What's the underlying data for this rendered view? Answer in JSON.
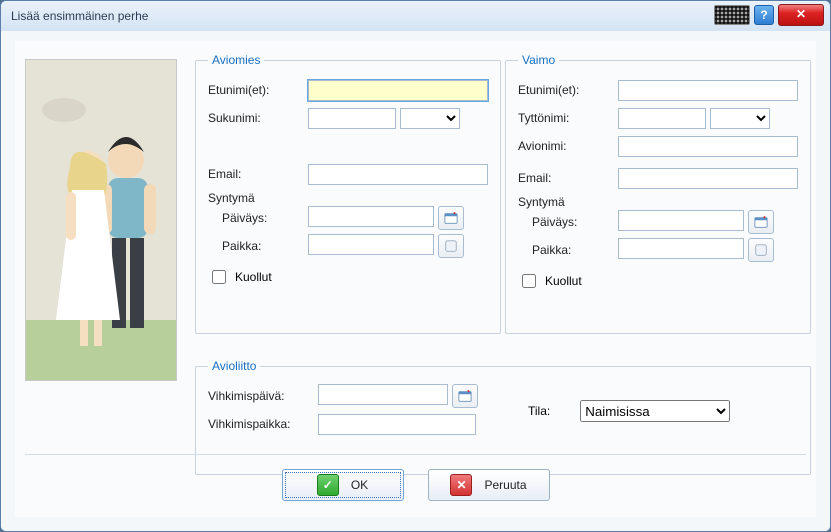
{
  "window": {
    "title": "Lisää ensimmäinen perhe"
  },
  "husband": {
    "legend": "Aviomies",
    "firstname_label": "Etunimi(et):",
    "surname_label": "Sukunimi:",
    "email_label": "Email:",
    "birth_label": "Syntymä",
    "date_label": "Päiväys:",
    "place_label": "Paikka:",
    "dead_label": "Kuollut",
    "firstname": "",
    "surname": "",
    "surname_suffix": "",
    "email": "",
    "birth_date": "",
    "birth_place": "",
    "dead": false
  },
  "wife": {
    "legend": "Vaimo",
    "firstname_label": "Etunimi(et):",
    "maiden_label": "Tyttönimi:",
    "married_name_label": "Avionimi:",
    "email_label": "Email:",
    "birth_label": "Syntymä",
    "date_label": "Päiväys:",
    "place_label": "Paikka:",
    "dead_label": "Kuollut",
    "firstname": "",
    "maiden": "",
    "maiden_suffix": "",
    "married_name": "",
    "email": "",
    "birth_date": "",
    "birth_place": "",
    "dead": false
  },
  "marriage": {
    "legend": "Avioliitto",
    "date_label": "Vihkimispäivä:",
    "place_label": "Vihkimispaikka:",
    "status_label": "Tila:",
    "date": "",
    "place": "",
    "status": "Naimisissa"
  },
  "buttons": {
    "ok": "OK",
    "cancel": "Peruuta"
  }
}
